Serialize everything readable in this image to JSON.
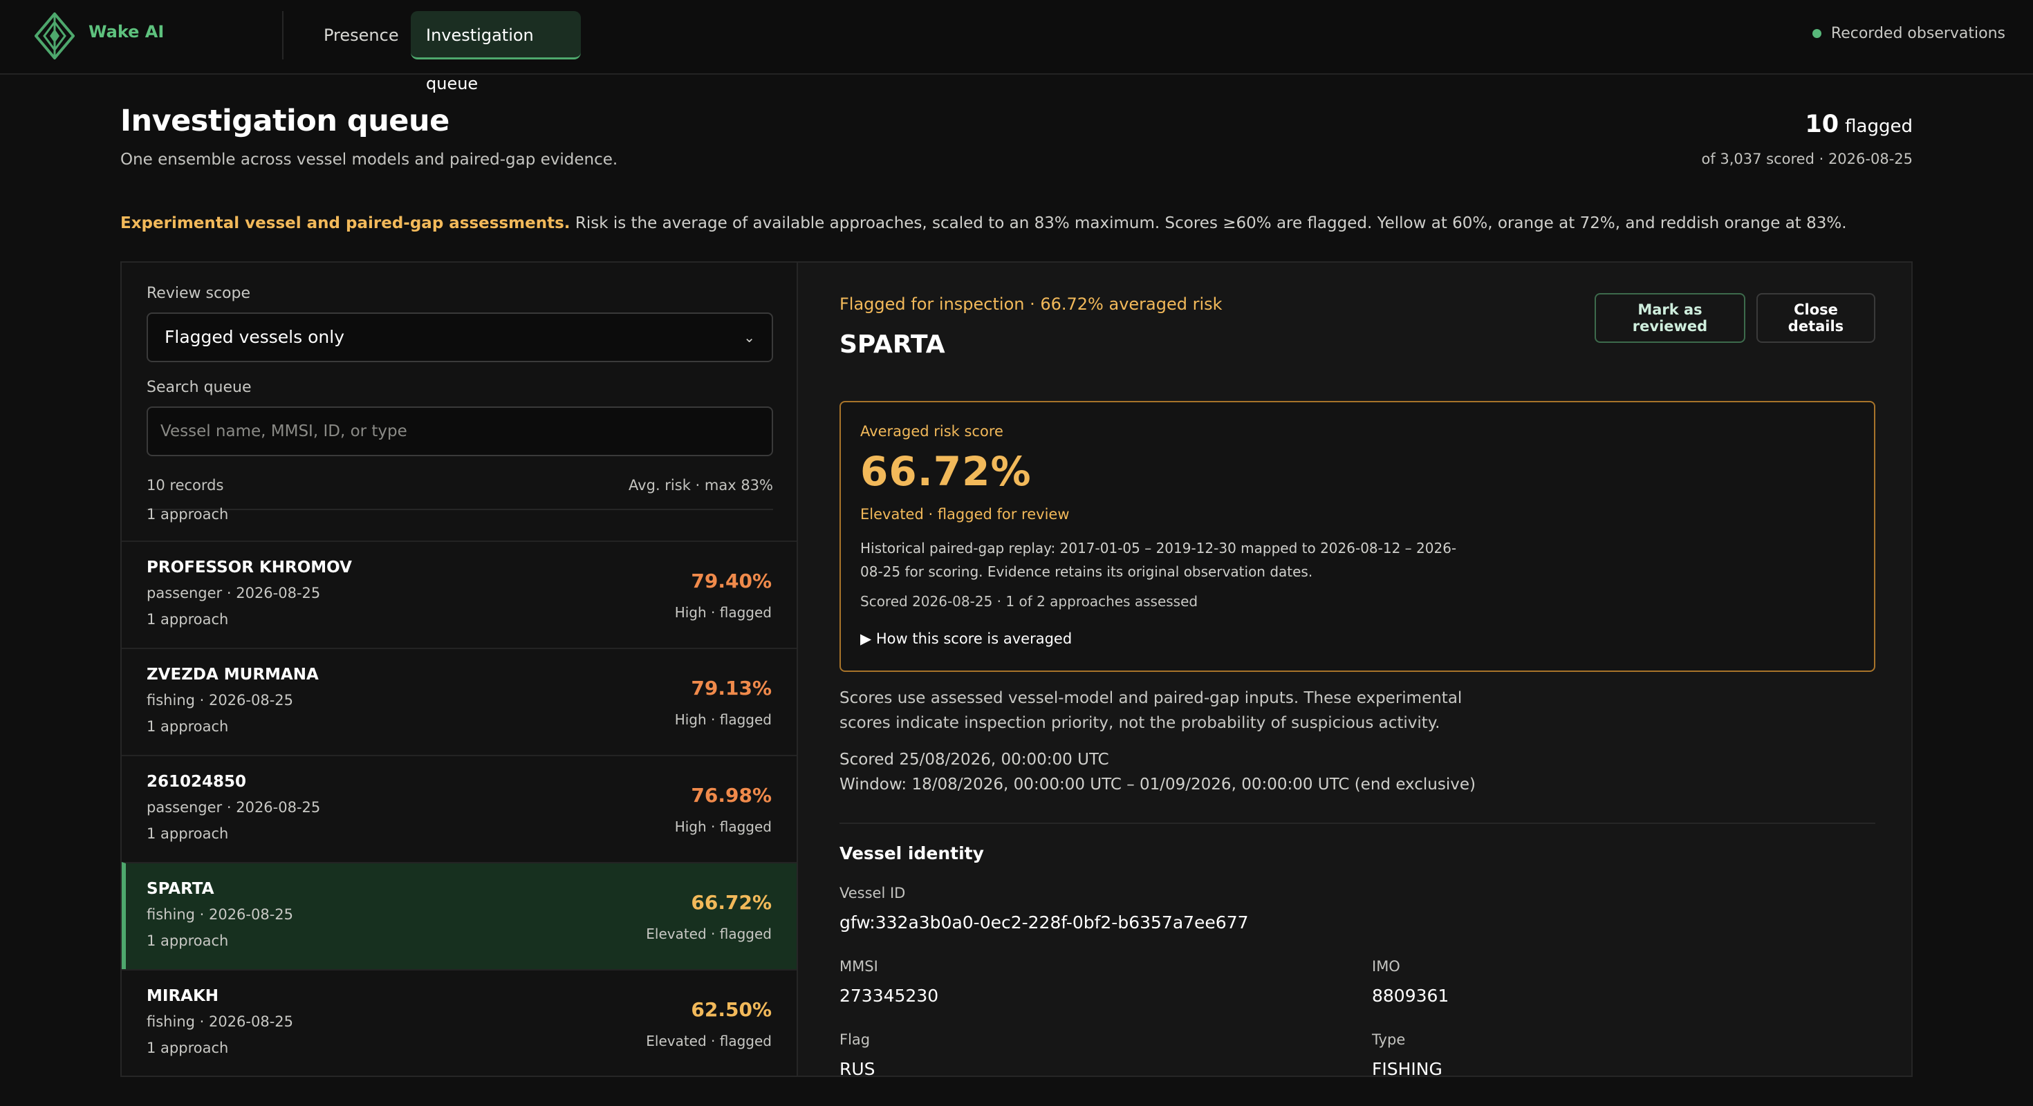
{
  "app": {
    "brand": "Wake AI",
    "nav": [
      {
        "label": "Presence"
      },
      {
        "label": "Investigation queue"
      }
    ],
    "recorded_label": "Recorded observations",
    "colors": {
      "accent": "#4ea86d",
      "warning": "#f2b95a",
      "high": "#f08a4b"
    }
  },
  "header": {
    "title": "Investigation queue",
    "subtitle": "One ensemble across vessel models and paired-gap evidence.",
    "flagged_count": "10",
    "flagged_label": "flagged",
    "scored_meta": "of 3,037 scored · 2026-08-25"
  },
  "notice": {
    "highlight": "Experimental vessel and paired-gap assessments.",
    "text": " Risk is the average of available approaches, scaled to an 83% maximum. Scores ≥60% are flagged. Yellow at 60%, orange at 72%, and reddish orange at 83%."
  },
  "filters": {
    "scope_label": "Review scope",
    "scope_value": "Flagged vessels only",
    "search_label": "Search queue",
    "search_placeholder": "Vessel name, MMSI, ID, or type",
    "records": "10 records",
    "sort_hint": "Avg. risk · max 83%"
  },
  "queue": {
    "partial_top": "1 approach",
    "items": [
      {
        "name": "PROFESSOR KHROMOV",
        "meta": "passenger · 2026-08-25",
        "approach": "1 approach",
        "score": "79.40%",
        "level": "High · flagged",
        "color": "#f08a4b"
      },
      {
        "name": "ZVEZDA MURMANA",
        "meta": "fishing · 2026-08-25",
        "approach": "1 approach",
        "score": "79.13%",
        "level": "High · flagged",
        "color": "#f08a4b"
      },
      {
        "name": "261024850",
        "meta": "passenger · 2026-08-25",
        "approach": "1 approach",
        "score": "76.98%",
        "level": "High · flagged",
        "color": "#f08a4b"
      },
      {
        "name": "SPARTA",
        "meta": "fishing · 2026-08-25",
        "approach": "1 approach",
        "score": "66.72%",
        "level": "Elevated · flagged",
        "color": "#f2b95a"
      },
      {
        "name": "MIRAKH",
        "meta": "fishing · 2026-08-25",
        "approach": "1 approach",
        "score": "62.50%",
        "level": "Elevated · flagged",
        "color": "#f2b95a"
      }
    ]
  },
  "details": {
    "flag_line": "Flagged for inspection · 66.72% averaged risk",
    "vessel_name": "SPARTA",
    "mark_reviewed": "Mark as reviewed",
    "close": "Close details",
    "risk_label": "Averaged risk score",
    "risk_value": "66.72%",
    "risk_status": "Elevated · flagged for review",
    "replay_note": "Historical paired-gap replay: 2017-01-05 – 2019-12-30 mapped to 2026-08-12 – 2026-08-25 for scoring. Evidence retains its original observation dates.",
    "scored_note": "Scored 2026-08-25 · 1 of 2 approaches assessed",
    "how_averaged": "How this score is averaged",
    "scores_note": "Scores use assessed vessel-model and paired-gap inputs. These experimental scores indicate inspection priority, not the probability of suspicious activity.",
    "scored_utc": "Scored 25/08/2026, 00:00:00 UTC",
    "window_utc": "Window: 18/08/2026, 00:00:00 UTC – 01/09/2026, 00:00:00 UTC (end exclusive)",
    "identity_title": "Vessel identity",
    "vessel_id_label": "Vessel ID",
    "vessel_id": "gfw:332a3b0a0-0ec2-228f-0bf2-b6357a7ee677",
    "mmsi_label": "MMSI",
    "mmsi": "273345230",
    "imo_label": "IMO",
    "imo": "8809361",
    "flag_label": "Flag",
    "flag": "RUS",
    "type_label": "Type",
    "type": "FISHING"
  }
}
